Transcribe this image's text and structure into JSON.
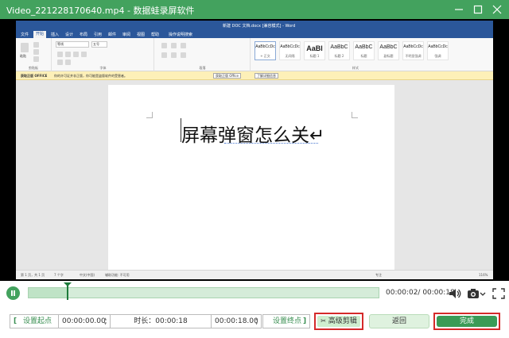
{
  "window": {
    "title": "Video_221228170640.mp4  -  数据蛙录屏软件",
    "controls": [
      "minimize-icon",
      "maximize-icon",
      "close-icon"
    ]
  },
  "word": {
    "doc_title": "新建 DOC 文档.docx [兼容模式] - Word",
    "tabs": [
      "文件",
      "开始",
      "插入",
      "设计",
      "布局",
      "引用",
      "邮件",
      "审阅",
      "视图",
      "帮助",
      "操作说明搜索"
    ],
    "ribbon": {
      "clipboard": "剪贴板",
      "font_name": "等线",
      "font_size": "五号",
      "font_group": "字体",
      "paragraph_group": "段落",
      "styles_group": "样式",
      "paste": "粘贴",
      "styles": [
        {
          "sample": "AaBbCcDc",
          "name": "+ 正文"
        },
        {
          "sample": "AaBbCcDc",
          "name": "无间隔"
        },
        {
          "sample": "AaBl",
          "name": "标题 1"
        },
        {
          "sample": "AaBbC",
          "name": "标题 2"
        },
        {
          "sample": "AaBbC",
          "name": "标题"
        },
        {
          "sample": "AaBbC",
          "name": "副标题"
        },
        {
          "sample": "AaBbCcDc",
          "name": "不明显强调"
        },
        {
          "sample": "AaBbCcDc",
          "name": "强调"
        }
      ]
    },
    "notice": {
      "title": "获取正版 OFFICE",
      "text": "你的许可证并非正版，你可能是盗版软件的受害者。",
      "btn1": "获取正版 Office",
      "btn2": "了解详细信息"
    },
    "document_text": "屏幕弹窗怎么关↵",
    "status": {
      "page": "第 1 页，共 1 页",
      "words": "7 个字",
      "lang": "中文(中国)",
      "access": "辅助功能: 不可用",
      "focus": "专注",
      "zoom": "116%"
    }
  },
  "player": {
    "timecode": "00:00:02/ 00:00:18",
    "progress": 0.11
  },
  "controls": {
    "set_start": "设置起点",
    "start_time": "00:00:00.00",
    "duration": "时长：00:00:18",
    "end_time": "00:00:18.00",
    "set_end": "设置终点",
    "advanced_edit": "高级剪辑",
    "back": "返回",
    "done": "完成"
  },
  "colors": {
    "accent": "#43a25e",
    "highlight_border": "#d42a2a",
    "word_blue": "#2b579a"
  }
}
